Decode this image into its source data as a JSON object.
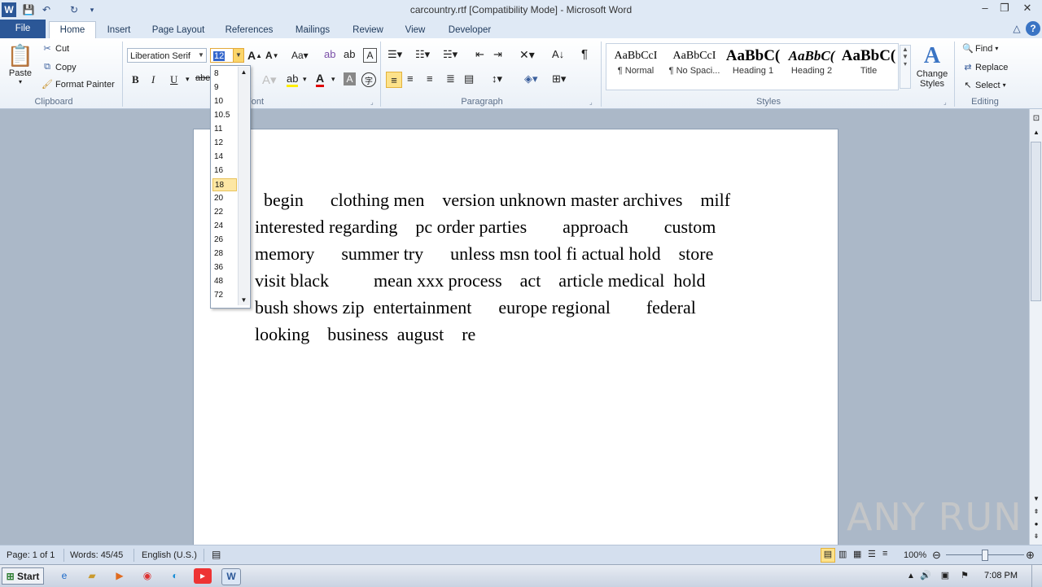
{
  "window": {
    "title": "carcountry.rtf [Compatibility Mode]  -  Microsoft Word",
    "controls": {
      "minimize": "–",
      "maximize": "❐",
      "close": "✕"
    }
  },
  "tabs": [
    "File",
    "Home",
    "Insert",
    "Page Layout",
    "References",
    "Mailings",
    "Review",
    "View",
    "Developer"
  ],
  "clipboard": {
    "paste": "Paste",
    "cut": "Cut",
    "copy": "Copy",
    "format_painter": "Format Painter",
    "label": "Clipboard"
  },
  "font": {
    "family": "Liberation Serif",
    "size": "12",
    "label": "Font",
    "bold": "B",
    "italic": "I",
    "underline": "U"
  },
  "paragraph": {
    "label": "Paragraph",
    "pilcrow": "¶"
  },
  "styles": {
    "label": "Styles",
    "items": [
      {
        "sample": "AaBbCcI",
        "name": "¶ Normal"
      },
      {
        "sample": "AaBbCcI",
        "name": "¶ No Spaci..."
      },
      {
        "sample": "AaBbC(",
        "name": "Heading 1"
      },
      {
        "sample": "AaBbC(",
        "name": "Heading 2"
      },
      {
        "sample": "AaBbC(",
        "name": "Title"
      }
    ],
    "change_styles": "Change Styles"
  },
  "editing": {
    "label": "Editing",
    "find": "Find",
    "replace": "Replace",
    "select": "Select"
  },
  "font_size_dropdown": {
    "options": [
      "8",
      "9",
      "10",
      "10.5",
      "11",
      "12",
      "14",
      "16",
      "18",
      "20",
      "22",
      "24",
      "26",
      "28",
      "36",
      "48",
      "72"
    ],
    "highlighted": "18"
  },
  "document": {
    "lines": [
      "  begin      clothing men    version unknown master archives    milf",
      "interested regarding    pc order parties        approach        custom",
      "memory      summer try      unless msn tool fi actual hold    store",
      "visit black          mean xxx process    act    article medical  hold",
      "bush shows zip  entertainment      europe regional        federal",
      "looking    business  august    re"
    ]
  },
  "status": {
    "page": "Page: 1 of 1",
    "words": "Words: 45/45",
    "language": "English (U.S.)",
    "zoom": "100%"
  },
  "taskbar": {
    "start": "Start",
    "clock": "7:08 PM"
  },
  "watermark": "ANY  RUN"
}
